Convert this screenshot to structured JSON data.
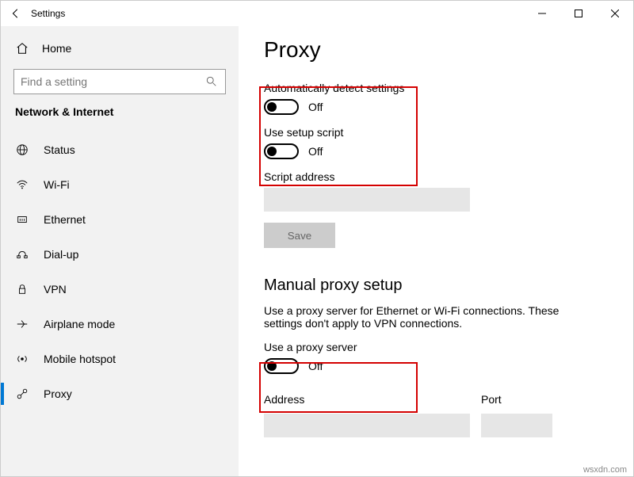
{
  "window": {
    "title": "Settings"
  },
  "sidebar": {
    "home": "Home",
    "search_placeholder": "Find a setting",
    "section": "Network & Internet",
    "items": [
      {
        "label": "Status"
      },
      {
        "label": "Wi-Fi"
      },
      {
        "label": "Ethernet"
      },
      {
        "label": "Dial-up"
      },
      {
        "label": "VPN"
      },
      {
        "label": "Airplane mode"
      },
      {
        "label": "Mobile hotspot"
      },
      {
        "label": "Proxy"
      }
    ]
  },
  "content": {
    "title": "Proxy",
    "auto_detect_label": "Automatically detect settings",
    "auto_detect_state": "Off",
    "setup_script_label": "Use setup script",
    "setup_script_state": "Off",
    "script_address_label": "Script address",
    "save_button": "Save",
    "manual_title": "Manual proxy setup",
    "manual_desc": "Use a proxy server for Ethernet or Wi-Fi connections. These settings don't apply to VPN connections.",
    "use_proxy_label": "Use a proxy server",
    "use_proxy_state": "Off",
    "address_label": "Address",
    "port_label": "Port"
  },
  "watermark": "wsxdn.com"
}
